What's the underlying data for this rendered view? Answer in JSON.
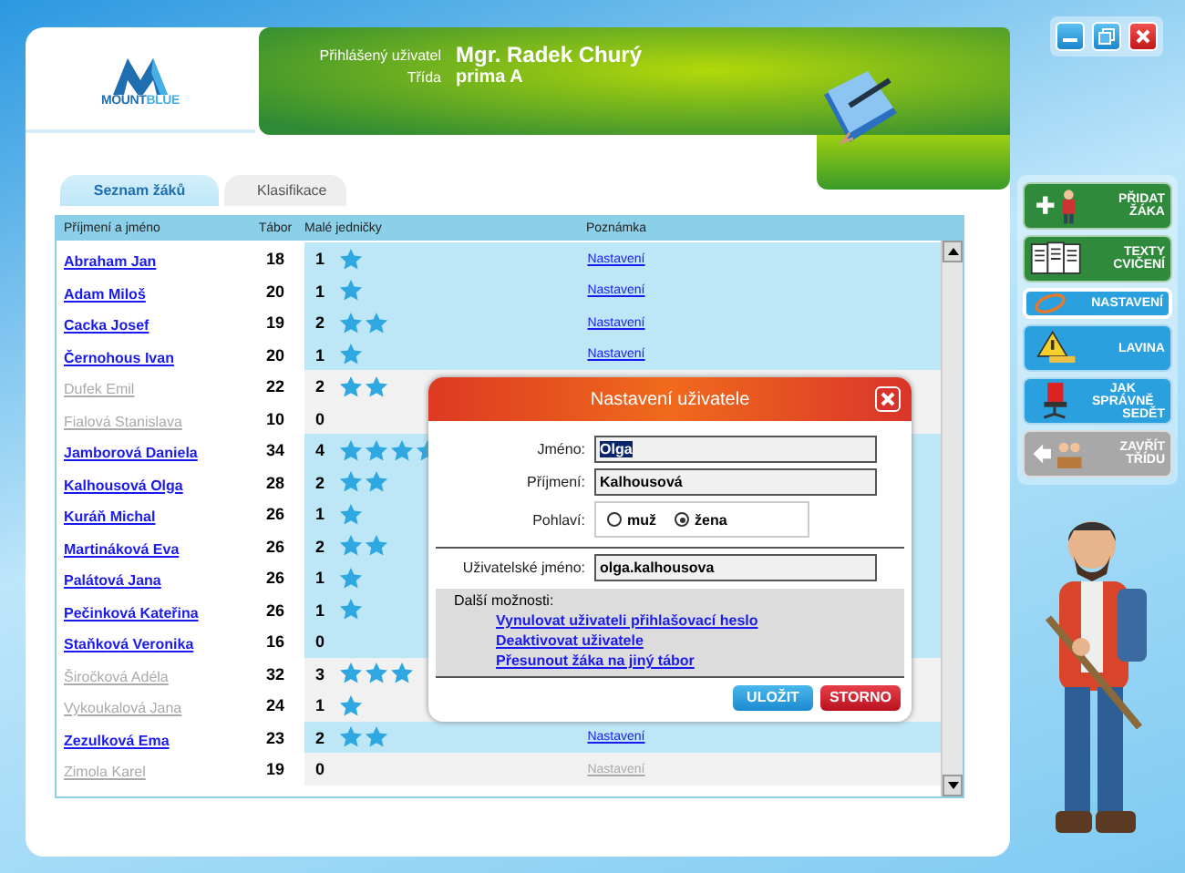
{
  "logo": {
    "part_1": "MOUNT",
    "part_2": "BLUE"
  },
  "header": {
    "user_label": "Přihlášený uživatel",
    "user": "Mgr. Radek Churý",
    "class_label": "Třída",
    "class": "prima A"
  },
  "tabs": [
    {
      "label": "Seznam žáků",
      "selected": true
    },
    {
      "label": "Klasifikace",
      "selected": false
    }
  ],
  "table": {
    "columns": [
      "Příjmení a jméno",
      "Tábor",
      "Malé jedničky",
      "Poznámka"
    ],
    "rows": [
      {
        "name": "Abraham Jan",
        "camp": "18",
        "count": "1",
        "active": true,
        "note": "Nastavení"
      },
      {
        "name": "Adam Miloš",
        "camp": "20",
        "count": "1",
        "active": true,
        "note": "Nastavení"
      },
      {
        "name": "Cacka Josef",
        "camp": "19",
        "count": "2",
        "active": true,
        "note": "Nastavení"
      },
      {
        "name": "Černohous Ivan",
        "camp": "20",
        "count": "1",
        "active": true,
        "note": "Nastavení"
      },
      {
        "name": "Dufek Emil",
        "camp": "22",
        "count": "2",
        "active": false
      },
      {
        "name": "Fialová Stanislava",
        "camp": "10",
        "count": "0",
        "active": false
      },
      {
        "name": "Jamborová Daniela",
        "camp": "34",
        "count": "4",
        "active": true
      },
      {
        "name": "Kalhousová Olga",
        "camp": "28",
        "count": "2",
        "active": true
      },
      {
        "name": "Kuráň Michal",
        "camp": "26",
        "count": "1",
        "active": true
      },
      {
        "name": "Martináková Eva",
        "camp": "26",
        "count": "2",
        "active": true
      },
      {
        "name": "Palátová Jana",
        "camp": "26",
        "count": "1",
        "active": true
      },
      {
        "name": "Pečinková Kateřina",
        "camp": "26",
        "count": "1",
        "active": true
      },
      {
        "name": "Staňková Veronika",
        "camp": "16",
        "count": "0",
        "active": true
      },
      {
        "name": "Širočková Adéla",
        "camp": "32",
        "count": "3",
        "active": false
      },
      {
        "name": "Vykoukalová Jana",
        "camp": "24",
        "count": "1",
        "active": false
      },
      {
        "name": "Zezulková Ema",
        "camp": "23",
        "count": "2",
        "active": true,
        "note": "Nastavení"
      },
      {
        "name": "Zimola Karel",
        "camp": "19",
        "count": "0",
        "active": false,
        "note": "Nastavení"
      }
    ]
  },
  "sidebar": {
    "items": [
      {
        "lines": [
          "PŘIDAT",
          "ŽÁKA"
        ],
        "kind": "add",
        "color": "#2f8a3c",
        "selected": false
      },
      {
        "lines": [
          "TEXTY",
          "CVIČENÍ"
        ],
        "kind": "texts",
        "color": "#2f8a3c",
        "selected": false
      },
      {
        "lines": [
          "NASTAVENÍ"
        ],
        "kind": "settings",
        "color": "#2ba0df",
        "selected": true
      },
      {
        "lines": [
          "LAVINA"
        ],
        "kind": "avalanche",
        "color": "#2ba0df",
        "selected": false
      },
      {
        "lines": [
          "JAK SPRÁVNĚ",
          "SEDĚT"
        ],
        "kind": "chair",
        "color": "#2ba0df",
        "selected": false
      },
      {
        "lines": [
          "ZAVŘÍT",
          "TŘÍDU"
        ],
        "kind": "close_class",
        "color": "#a8a8a8",
        "selected": false
      }
    ]
  },
  "dialog": {
    "title": "Nastavení uživatele",
    "fields": [
      {
        "label": "Jméno:",
        "value": "Olga",
        "highlighted": true
      },
      {
        "label": "Příjmení:",
        "value": "Kalhousová",
        "highlighted": false
      }
    ],
    "gender": {
      "label": "Pohlaví:",
      "options": [
        {
          "label": "muž",
          "selected": false
        },
        {
          "label": "žena",
          "selected": true
        }
      ]
    },
    "username": {
      "label": "Uživatelské jméno:",
      "value": "olga.kalhousova"
    },
    "more": {
      "title": "Další možnosti:",
      "links": [
        "Vynulovat uživateli přihlašovací heslo",
        "Deaktivovat uživatele",
        "Přesunout žáka na jiný tábor"
      ]
    },
    "buttons": [
      {
        "label": "ULOŽIT",
        "kind": "primary"
      },
      {
        "label": "STORNO",
        "kind": "cancel"
      }
    ]
  }
}
